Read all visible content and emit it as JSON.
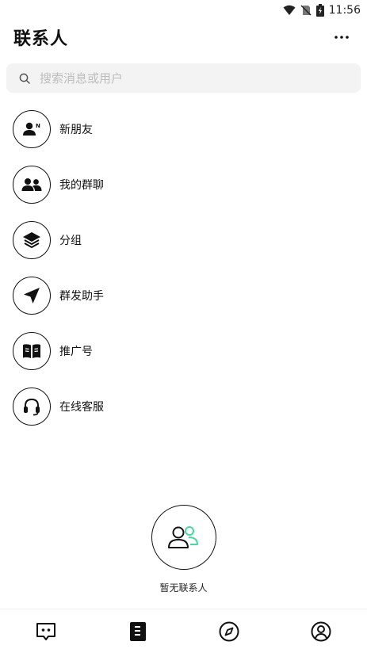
{
  "status_bar": {
    "time": "11:56"
  },
  "header": {
    "title": "联系人",
    "more_icon": "more-icon"
  },
  "search": {
    "placeholder": "搜索消息或用户",
    "value": ""
  },
  "menu": {
    "items": [
      {
        "label": "新朋友",
        "icon": "new-friend-icon"
      },
      {
        "label": "我的群聊",
        "icon": "group-chat-icon"
      },
      {
        "label": "分组",
        "icon": "layers-icon"
      },
      {
        "label": "群发助手",
        "icon": "send-icon"
      },
      {
        "label": "推广号",
        "icon": "book-icon"
      },
      {
        "label": "在线客服",
        "icon": "headset-icon"
      }
    ]
  },
  "empty_state": {
    "text": "暂无联系人",
    "icon": "contacts-empty-icon"
  },
  "colors": {
    "accent_green": "#4cd6a0",
    "text": "#111111",
    "search_bg": "#f3f3f3"
  },
  "bottom_nav": {
    "items": [
      {
        "icon": "chat-icon"
      },
      {
        "icon": "contacts-icon",
        "active": true
      },
      {
        "icon": "compass-icon"
      },
      {
        "icon": "profile-icon"
      }
    ]
  }
}
